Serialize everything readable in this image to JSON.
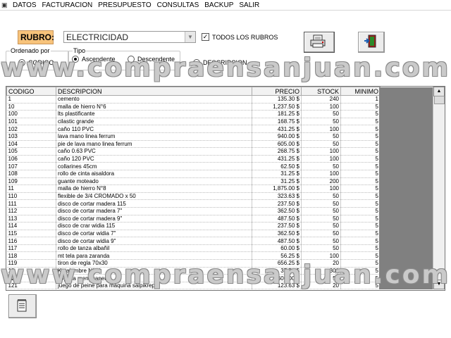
{
  "menu": {
    "items": [
      "DATOS",
      "FACTURACION",
      "PRESUPUESTO",
      "CONSULTAS",
      "BACKUP",
      "SALIR"
    ]
  },
  "toolbar": {
    "rubro_label": "RUBRO:",
    "rubro_value": "ELECTRICIDAD",
    "todos_label": "TODOS LOS RUBROS",
    "todos_checked": true,
    "print_icon": "printer-icon",
    "exit_icon": "exit-door-icon"
  },
  "ordenado": {
    "title": "Ordenado por",
    "codigo_label": "CODIGO",
    "descripcion_label": "DESCRIPCION",
    "selected": "codigo"
  },
  "tipo": {
    "title": "Tipo",
    "asc_label": "Ascendente",
    "desc_label": "Descendente",
    "selected": "asc"
  },
  "watermark": "www.compraensanjuan.com",
  "table": {
    "headers": [
      "CODIGO",
      "DESCRIPCION",
      "PRECIO",
      "STOCK",
      "MINIMO"
    ],
    "rows": [
      [
        "1",
        "cemento",
        "135.30 $",
        "240",
        "1"
      ],
      [
        "10",
        "malla de hierro N°6",
        "1,237.50 $",
        "100",
        "5"
      ],
      [
        "100",
        "lts plastificante",
        "181.25 $",
        "50",
        "5"
      ],
      [
        "101",
        "cilastic grande",
        "168.75 $",
        "50",
        "5"
      ],
      [
        "102",
        "caño 110 PVC",
        "431.25 $",
        "100",
        "5"
      ],
      [
        "103",
        "lava mano linea ferrum",
        "940.00 $",
        "50",
        "5"
      ],
      [
        "104",
        "pie de lava mano linea ferrum",
        "605.00 $",
        "50",
        "5"
      ],
      [
        "105",
        "caño 0.63 PVC",
        "268.75 $",
        "100",
        "5"
      ],
      [
        "106",
        "caño 120 PVC",
        "431.25 $",
        "100",
        "5"
      ],
      [
        "107",
        "collarines 45cm",
        "62.50 $",
        "50",
        "5"
      ],
      [
        "108",
        "rollo de cinta aisaldora",
        "31.25 $",
        "100",
        "5"
      ],
      [
        "109",
        "guante moteado",
        "31.25 $",
        "200",
        "5"
      ],
      [
        "11",
        "malla de hierro N°8",
        "1,875.00 $",
        "100",
        "5"
      ],
      [
        "110",
        "flexible de 3/4 CROMADO x 50",
        "323.63 $",
        "50",
        "5"
      ],
      [
        "111",
        "disco de cortar madera 115",
        "237.50 $",
        "50",
        "5"
      ],
      [
        "112",
        "disco de cortar  madera 7\"",
        "362.50 $",
        "50",
        "5"
      ],
      [
        "113",
        "disco de cortar madera 9\"",
        "487.50 $",
        "50",
        "5"
      ],
      [
        "114",
        "disco de crar widia 115",
        "237.50 $",
        "50",
        "5"
      ],
      [
        "115",
        "disco de cortar widia 7\"",
        "362.50 $",
        "50",
        "5"
      ],
      [
        "116",
        "disco de cortar widia 9\"",
        "487.50 $",
        "50",
        "5"
      ],
      [
        "117",
        "rollo de tanza albañil",
        "60.00 $",
        "50",
        "5"
      ],
      [
        "118",
        "mt tela para zaranda",
        "56.25 $",
        "100",
        "5"
      ],
      [
        "119",
        "tiron de regla 70x30",
        "656.25 $",
        "20",
        "5"
      ],
      [
        "12",
        "Kg alambre N°14",
        "37.50 $",
        "300",
        "5"
      ],
      [
        "120",
        "sopleta membranera",
        "600.00 $",
        "50",
        "5"
      ],
      [
        "121",
        "juego de peine para maquina salpikrep",
        "123.63 $",
        "20",
        "5"
      ]
    ]
  },
  "bottom": {
    "icon": "notepad-icon"
  }
}
